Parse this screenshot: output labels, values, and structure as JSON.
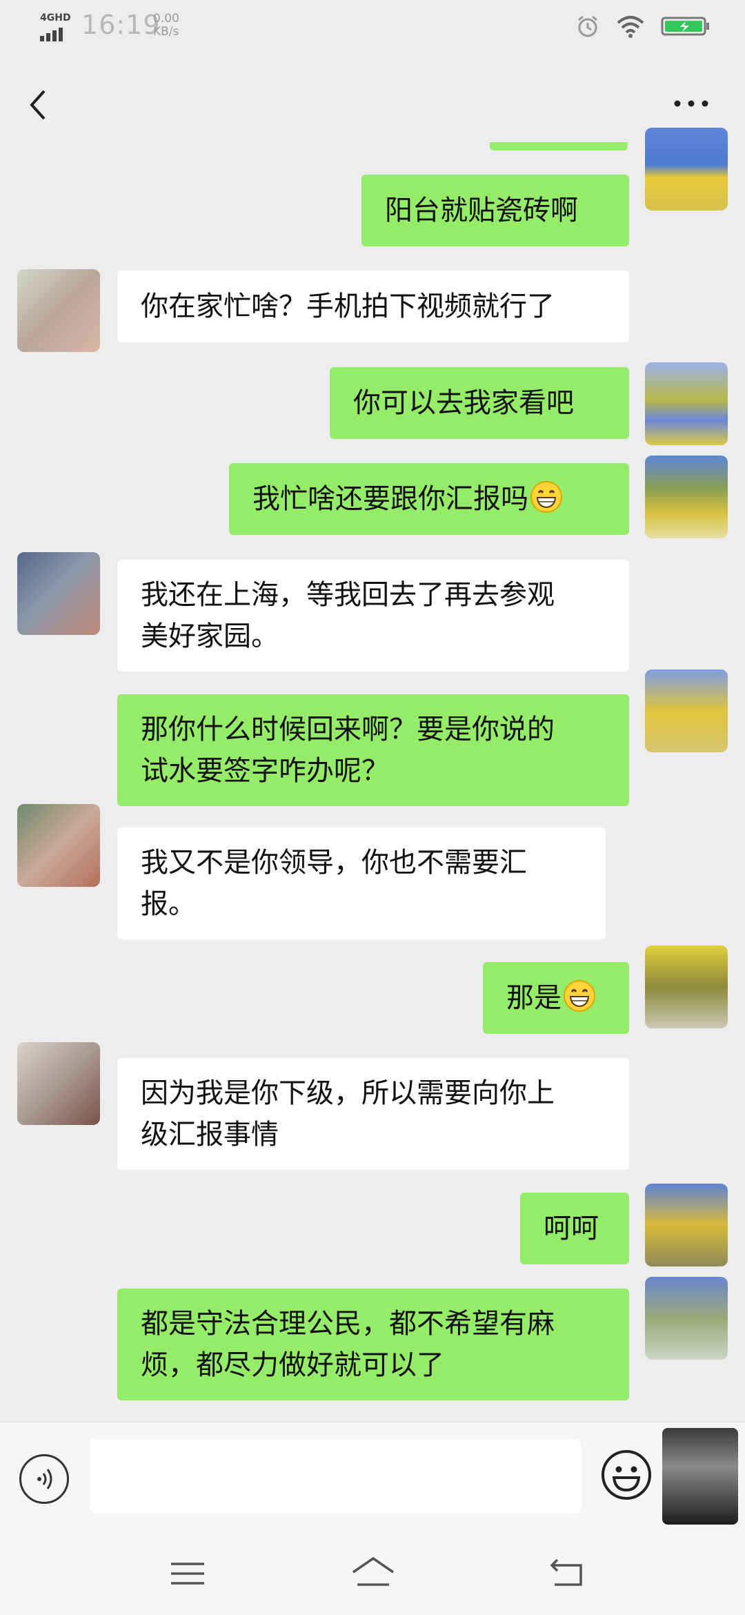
{
  "status_bar": {
    "network": "4GHD",
    "time": "16:19",
    "speed_value": "0.00",
    "speed_unit": "KB/s"
  },
  "header": {
    "back_icon": "chevron-left-icon",
    "more_icon": "more-dots-icon"
  },
  "messages": [
    {
      "side": "out",
      "lines": [
        "阳台就贴瓷砖啊"
      ]
    },
    {
      "side": "in",
      "lines": [
        "你在家忙啥？手机拍下视频就行了"
      ]
    },
    {
      "side": "out",
      "lines": [
        "你可以去我家看吧"
      ]
    },
    {
      "side": "out",
      "lines": [
        "我忙啥还要跟你汇报吗"
      ],
      "emoji": "grinning-face"
    },
    {
      "side": "in",
      "lines": [
        "我还在上海，等我回去了再去参观",
        "美好家园。"
      ]
    },
    {
      "side": "out",
      "lines": [
        "那你什么时候回来啊？要是你说的",
        "试水要签字咋办呢？"
      ]
    },
    {
      "side": "in",
      "lines": [
        "我又不是你领导，你也不需要汇",
        "报。"
      ]
    },
    {
      "side": "out",
      "lines": [
        "那是"
      ],
      "emoji": "grinning-face"
    },
    {
      "side": "in",
      "lines": [
        "因为我是你下级，所以需要向你上",
        "级汇报事情"
      ]
    },
    {
      "side": "out",
      "lines": [
        "呵呵"
      ]
    },
    {
      "side": "out",
      "lines": [
        "都是守法合理公民，都不希望有麻",
        "烦，都尽力做好就可以了"
      ]
    }
  ],
  "input_bar": {
    "voice_icon": "voice-icon",
    "input_value": "",
    "emoji_icon": "smiley-icon"
  },
  "nav_bar": {
    "icons": [
      "menu-icon",
      "home-icon",
      "back-nav-icon"
    ]
  },
  "colors": {
    "outgoing_bubble": "#95ec69",
    "incoming_bubble": "#ffffff",
    "background": "#ededed"
  }
}
